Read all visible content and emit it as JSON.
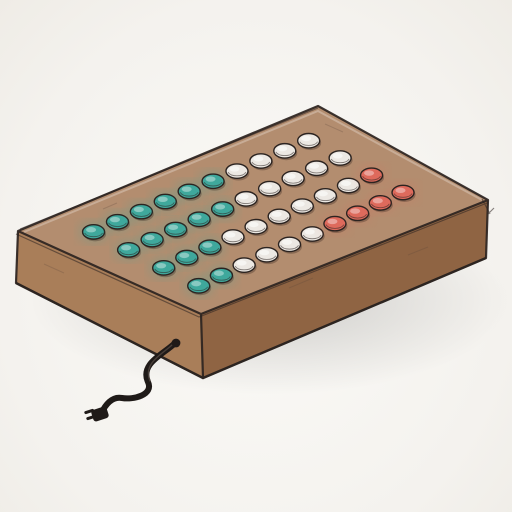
{
  "scene": {
    "subject": "button-box-controller",
    "colors": {
      "paper": "#f6f5f1",
      "wood_top": "#b38d6f",
      "wood_front": "#a97e59",
      "wood_side": "#8f6443",
      "ink": "#2b2320",
      "cable": "#1f1a18",
      "button_teal": "#3fa89c",
      "button_white": "#ece8e3",
      "button_red": "#de6a5c"
    },
    "buttons": {
      "total": 40,
      "teal_count": 16,
      "red_count": 5,
      "white_count": 19
    },
    "cable": {
      "connector": "plug",
      "icon": "plug-icon"
    }
  }
}
